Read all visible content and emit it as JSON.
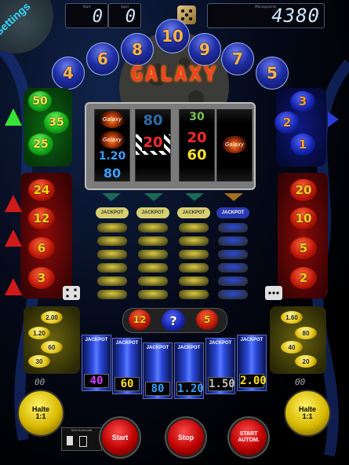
{
  "settings": {
    "label": "Settings"
  },
  "top": {
    "left_counter_label": "Start",
    "left_counter_value": "0",
    "mid_counter_label": "Spiel",
    "mid_counter_value": "0",
    "credit_label": "Münzspeicher",
    "credit_value": "4380"
  },
  "title": "GALAXY",
  "arc_balls": [
    "4",
    "6",
    "8",
    "10",
    "9",
    "7",
    "5"
  ],
  "left_green": [
    "50",
    "35",
    "25"
  ],
  "right_blue": [
    "3",
    "2",
    "1"
  ],
  "left_red": [
    "24",
    "12",
    "6",
    "3"
  ],
  "right_red": [
    "20",
    "10",
    "5",
    "2"
  ],
  "reels": {
    "r1": [
      "Galaxy",
      "Galaxy",
      "1.20",
      "80"
    ],
    "r2": [
      "80",
      "20",
      ""
    ],
    "r3": [
      "30",
      "20",
      "60"
    ],
    "r4": [
      "",
      "Galaxy",
      ""
    ]
  },
  "jackpot_label": "JACKPOT",
  "left_payouts": [
    "2.00",
    "1.20",
    "60",
    "30"
  ],
  "right_payouts": [
    "1.60",
    "80",
    "40",
    "20"
  ],
  "risk_balls": [
    "12",
    "?",
    "5"
  ],
  "tubes": [
    "40",
    "60",
    "80",
    "1.20",
    "1.50",
    "2.00"
  ],
  "small_counts": {
    "left": "00",
    "right": "00"
  },
  "nudge": {
    "left": "Halte 1:1",
    "right": "Halte 1:1"
  },
  "buttons": {
    "start": "Start",
    "stop": "Stop",
    "start_auto": "START AUTOM."
  },
  "auto_panel_label": "Start Automatik"
}
